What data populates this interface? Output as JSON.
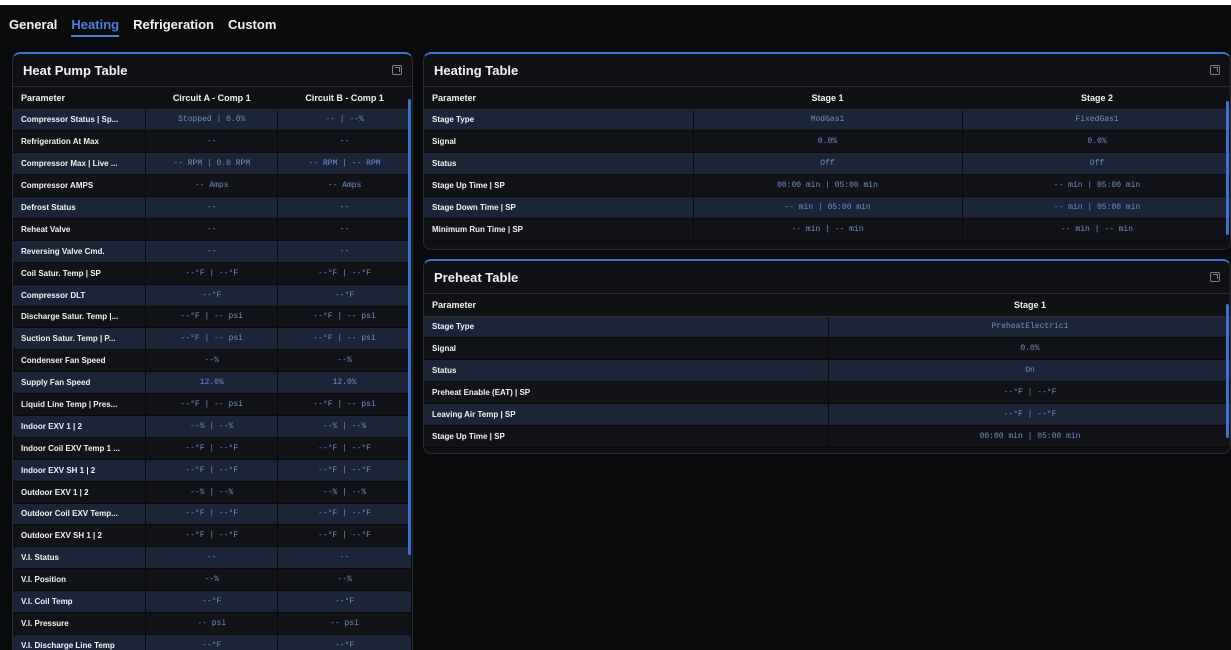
{
  "tabs": [
    {
      "label": "General"
    },
    {
      "label": "Heating"
    },
    {
      "label": "Refrigeration"
    },
    {
      "label": "Custom"
    }
  ],
  "heat_pump": {
    "title": "Heat Pump Table",
    "headers": [
      "Parameter",
      "Circuit A - Comp 1",
      "Circuit B - Comp 1"
    ],
    "rows": [
      [
        "Compressor Status | Sp...",
        "Stopped | 0.0%",
        "-- | --%"
      ],
      [
        "Refrigeration At Max",
        "--",
        "--"
      ],
      [
        "Compressor Max | Live ...",
        "-- RPM | 0.0 RPM",
        "-- RPM | -- RPM"
      ],
      [
        "Compressor AMPS",
        "-- Amps",
        "-- Amps"
      ],
      [
        "Defrost Status",
        "--",
        "--"
      ],
      [
        "Reheat Valve",
        "--",
        "--"
      ],
      [
        "Reversing Valve Cmd.",
        "--",
        "--"
      ],
      [
        "Coil Satur. Temp | SP",
        "--°F | --°F",
        "--°F | --°F"
      ],
      [
        "Compressor DLT",
        "--°F",
        "--°F"
      ],
      [
        "Discharge Satur. Temp |...",
        "--°F | -- psi",
        "--°F | -- psi"
      ],
      [
        "Suction Satur. Temp | P...",
        "--°F | -- psi",
        "--°F | -- psi"
      ],
      [
        "Condenser Fan Speed",
        "--%",
        "--%"
      ],
      [
        "Supply Fan Speed",
        "12.0%",
        "12.0%"
      ],
      [
        "Liquid Line Temp | Pres...",
        "--°F | -- psi",
        "--°F | -- psi"
      ],
      [
        "Indoor EXV 1 | 2",
        "--% | --%",
        "--% | --%"
      ],
      [
        "Indoor Coil EXV Temp 1 ...",
        "--°F | --°F",
        "--°F | --°F"
      ],
      [
        "Indoor EXV SH 1 | 2",
        "--°F | --°F",
        "--°F | --°F"
      ],
      [
        "Outdoor EXV 1 | 2",
        "--% | --%",
        "--% | --%"
      ],
      [
        "Outdoor Coil EXV Temp...",
        "--°F | --°F",
        "--°F | --°F"
      ],
      [
        "Outdoor EXV SH 1 | 2",
        "--°F | --°F",
        "--°F | --°F"
      ],
      [
        "V.I. Status",
        "--",
        "--"
      ],
      [
        "V.I. Position",
        "--%",
        "--%"
      ],
      [
        "V.I. Coil Temp",
        "--°F",
        "--°F"
      ],
      [
        "V.I. Pressure",
        "-- psi",
        "-- psi"
      ],
      [
        "V.I. Discharge Line Temp",
        "--°F",
        "--°F"
      ]
    ]
  },
  "heating": {
    "title": "Heating Table",
    "headers": [
      "Parameter",
      "Stage 1",
      "Stage 2"
    ],
    "rows": [
      [
        "Stage Type",
        "ModGas1",
        "FixedGas1"
      ],
      [
        "Signal",
        "0.0%",
        "0.0%"
      ],
      [
        "Status",
        "Off",
        "Off"
      ],
      [
        "Stage Up Time | SP",
        "00:00 min | 05:00 min",
        "-- min | 05:00 min"
      ],
      [
        "Stage Down Time | SP",
        "-- min | 05:00 min",
        "-- min | 05:00 min"
      ],
      [
        "Minimum Run Time | SP",
        "-- min | -- min",
        "-- min | -- min"
      ]
    ]
  },
  "preheat": {
    "title": "Preheat Table",
    "headers": [
      "Parameter",
      "Stage 1"
    ],
    "rows": [
      [
        "Stage Type",
        "PreheatElectric1"
      ],
      [
        "Signal",
        "0.0%"
      ],
      [
        "Status",
        "On"
      ],
      [
        "Preheat Enable (EAT) | SP",
        "--°F | --°F"
      ],
      [
        "Leaving Air Temp | SP",
        "--°F | --°F"
      ],
      [
        "Stage Up Time | SP",
        "00:00 min | 05:00 min"
      ]
    ]
  },
  "colors": {
    "accent": "#3f6fcf",
    "value_text": "#6f8fcf",
    "row_alt": "#1b2537"
  }
}
